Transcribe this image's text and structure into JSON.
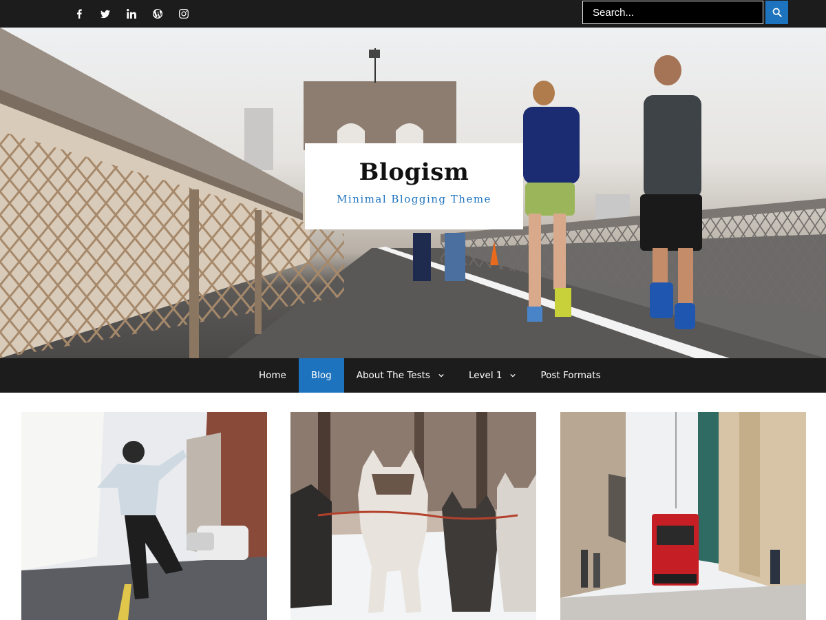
{
  "topbar": {
    "social_icons": [
      "facebook-icon",
      "twitter-icon",
      "linkedin-icon",
      "wordpress-icon",
      "instagram-icon"
    ],
    "search": {
      "placeholder": "Search..."
    }
  },
  "hero": {
    "site_title": "Blogism",
    "tagline": "Minimal Blogging Theme"
  },
  "nav": {
    "items": [
      {
        "label": "Home"
      },
      {
        "label": "Blog",
        "active": true
      },
      {
        "label": "About The Tests",
        "has_submenu": true
      },
      {
        "label": "Level 1",
        "has_submenu": true
      },
      {
        "label": "Post Formats"
      }
    ]
  },
  "posts": {
    "thumbnails": [
      "dancer-street-photo",
      "sled-dogs-photo",
      "red-tram-street-photo"
    ]
  },
  "colors": {
    "accent": "#1e73be",
    "bar": "#1c1c1c"
  }
}
